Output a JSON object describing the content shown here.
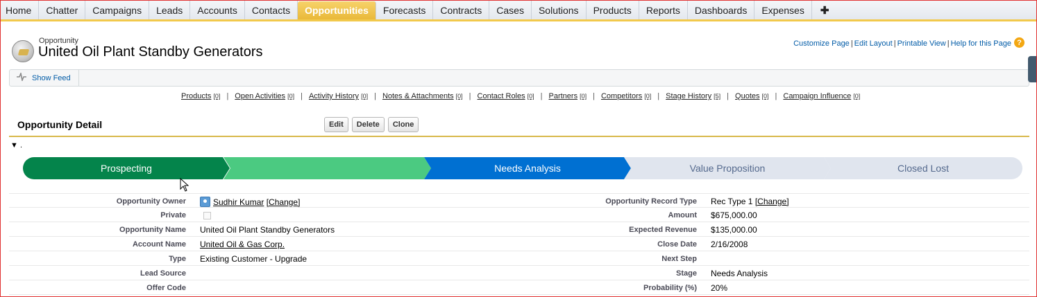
{
  "tabs": [
    {
      "label": "Home"
    },
    {
      "label": "Chatter"
    },
    {
      "label": "Campaigns"
    },
    {
      "label": "Leads"
    },
    {
      "label": "Accounts"
    },
    {
      "label": "Contacts"
    },
    {
      "label": "Opportunities",
      "active": true
    },
    {
      "label": "Forecasts"
    },
    {
      "label": "Contracts"
    },
    {
      "label": "Cases"
    },
    {
      "label": "Solutions"
    },
    {
      "label": "Products"
    },
    {
      "label": "Reports"
    },
    {
      "label": "Dashboards"
    },
    {
      "label": "Expenses"
    },
    {
      "label": "✚"
    }
  ],
  "header": {
    "object_type": "Opportunity",
    "title": "United Oil Plant Standby Generators",
    "icon": "opportunity-coin-icon",
    "links": [
      "Customize Page",
      "Edit Layout",
      "Printable View",
      "Help for this Page"
    ],
    "help_glyph": "?"
  },
  "feed": {
    "label": "Show Feed",
    "icon": "feed-pulse-icon"
  },
  "related": [
    {
      "label": "Products",
      "count": "[0]"
    },
    {
      "label": "Open Activities",
      "count": "[0]"
    },
    {
      "label": "Activity History",
      "count": "[0]"
    },
    {
      "label": "Notes & Attachments",
      "count": "[0]"
    },
    {
      "label": "Contact Roles",
      "count": "[0]"
    },
    {
      "label": "Partners",
      "count": "[0]"
    },
    {
      "label": "Competitors",
      "count": "[0]"
    },
    {
      "label": "Stage History",
      "count": "[5]"
    },
    {
      "label": "Quotes",
      "count": "[0]"
    },
    {
      "label": "Campaign Influence",
      "count": "[0]"
    }
  ],
  "detail": {
    "title": "Opportunity Detail",
    "buttons": {
      "edit": "Edit",
      "delete": "Delete",
      "clone": "Clone"
    },
    "collapse_label": "▼ ."
  },
  "path": {
    "stages": [
      "Prospecting",
      "",
      "Needs Analysis",
      "Value Proposition",
      "Closed Lost"
    ],
    "colors": {
      "complete": "#04844b",
      "complete_light": "#4bca81",
      "current": "#0070d2",
      "incomplete": "#e0e5ee"
    }
  },
  "fields": {
    "owner_label": "Opportunity Owner",
    "owner_name": "Sudhir Kumar",
    "owner_change": "[Change]",
    "record_type_label": "Opportunity Record Type",
    "record_type_value": "Rec Type 1",
    "record_type_change": "[Change]",
    "private_label": "Private",
    "amount_label": "Amount",
    "amount_value": "$675,000.00",
    "name_label": "Opportunity Name",
    "name_value": "United Oil Plant Standby Generators",
    "expected_revenue_label": "Expected Revenue",
    "expected_revenue_value": "$135,000.00",
    "account_label": "Account Name",
    "account_value": "United Oil & Gas Corp.",
    "close_date_label": "Close Date",
    "close_date_value": "2/16/2008",
    "type_label": "Type",
    "type_value": "Existing Customer - Upgrade",
    "next_step_label": "Next Step",
    "lead_source_label": "Lead Source",
    "stage_label": "Stage",
    "stage_value": "Needs Analysis",
    "offer_code_label": "Offer Code",
    "probability_label": "Probability (%)",
    "probability_value": "20%"
  }
}
